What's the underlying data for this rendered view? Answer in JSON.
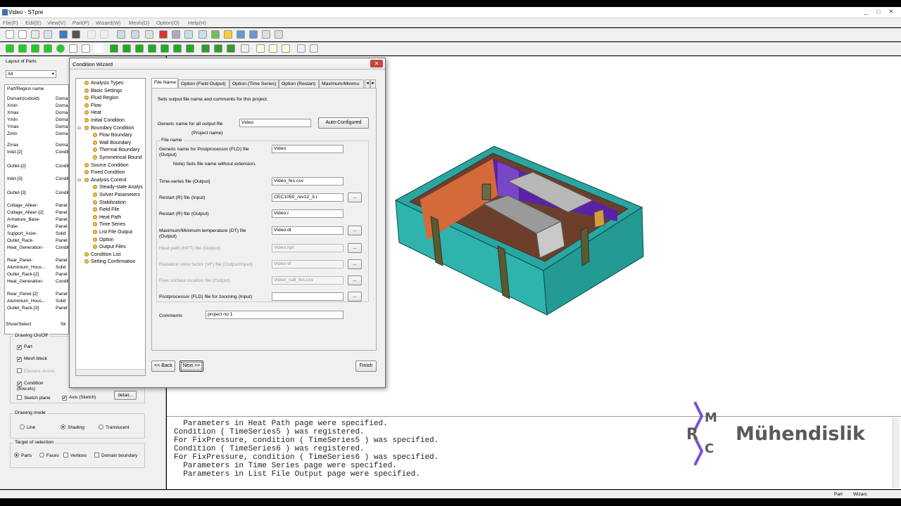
{
  "window": {
    "title": "Video - STpre"
  },
  "menu": [
    "File(F)",
    "Edit(E)",
    "View(V)",
    "Part(P)",
    "Wizard(W)",
    "Mesh(G)",
    "Option(O)",
    "Help(H)"
  ],
  "left_panel": {
    "tab_layout": "Layout of Parts",
    "filter_value": "All",
    "col_part": "Part/Region name",
    "rows": [
      {
        "name": "Domain(cuboid)",
        "type": "Doma"
      },
      {
        "name": "Xmin",
        "type": "Doma"
      },
      {
        "name": "Xmax",
        "type": "Doma"
      },
      {
        "name": "Ymin",
        "type": "Doma"
      },
      {
        "name": "Ymax",
        "type": "Doma"
      },
      {
        "name": "Zmin",
        "type": "Doma"
      },
      {
        "name": "Zmax",
        "type": "Doma"
      },
      {
        "name": "Inlet-[2]",
        "type": "Conditi"
      },
      {
        "name": "Outlet-[2]",
        "type": "Conditi"
      },
      {
        "name": "Inlet-[3]",
        "type": "Conditi"
      },
      {
        "name": "Outlet-[3]",
        "type": "Conditi"
      },
      {
        "name": "Collage_Alleer-",
        "type": "Panel"
      },
      {
        "name": "Collage_Alleer-[2]",
        "type": "Panel"
      },
      {
        "name": "Armature_Base-",
        "type": "Panel"
      },
      {
        "name": "Poile-",
        "type": "Panel"
      },
      {
        "name": "Support_Acier-",
        "type": "Solid"
      },
      {
        "name": "Outlet_Rack-",
        "type": "Panel"
      },
      {
        "name": "Heat_Generation-",
        "type": "Conditi"
      },
      {
        "name": "Rear_Panel-",
        "type": "Panel"
      },
      {
        "name": "Aluminium_Hous...",
        "type": "Solid"
      },
      {
        "name": "Outlet_Rack-[2]",
        "type": "Panel"
      },
      {
        "name": "Heat_Generation-",
        "type": "Conditi"
      },
      {
        "name": "Rear_Panel-[2]",
        "type": "Panel"
      },
      {
        "name": "Aluminium_Hous...",
        "type": "Solid"
      },
      {
        "name": "Outlet_Rack-[3]",
        "type": "Panel"
      }
    ],
    "tab_show": "Show/Select",
    "tab_sketch": "Sk",
    "drawing_onoff": "Drawing On/Off",
    "part": "Part",
    "mesh_block": "Mesh block",
    "element_division": "Element divisio",
    "condition": "Condition (flow,etc)",
    "sketch_plane": "Sketch plane",
    "axis_sketch": "Axis (Sketch)",
    "detail": "detail...",
    "drawing_mode": "Drawing mode",
    "mode_line": "Line",
    "mode_shading": "Shading",
    "mode_translucent": "Translucent",
    "target": "Target of selection",
    "t_parts": "Parts",
    "t_faces": "Faces",
    "t_vertices": "Vertices",
    "t_domain": "Domain boundary"
  },
  "dialog": {
    "title": "Condition Wizard",
    "tree": [
      {
        "label": "Analysis Types",
        "level": 0
      },
      {
        "label": "Basic Settings",
        "level": 0
      },
      {
        "label": "Fluid Region",
        "level": 0
      },
      {
        "label": "Flow",
        "level": 0
      },
      {
        "label": "Heat",
        "level": 0
      },
      {
        "label": "Initial Condition",
        "level": 0
      },
      {
        "label": "Boundary Condition",
        "level": 0
      },
      {
        "label": "Flow Boundary",
        "level": 1
      },
      {
        "label": "Wall Boundary",
        "level": 1
      },
      {
        "label": "Thermal Boundary",
        "level": 1
      },
      {
        "label": "Symmetrical Bound",
        "level": 1
      },
      {
        "label": "Source Condition",
        "level": 0
      },
      {
        "label": "Fixed Condition",
        "level": 0
      },
      {
        "label": "Analysis Control",
        "level": 0
      },
      {
        "label": "Steady-state Analys",
        "level": 1
      },
      {
        "label": "Solver Parameters",
        "level": 1
      },
      {
        "label": "Stabilization",
        "level": 1
      },
      {
        "label": "Field File",
        "level": 1
      },
      {
        "label": "Heat Path",
        "level": 1
      },
      {
        "label": "Time Series",
        "level": 1
      },
      {
        "label": "List File Output",
        "level": 1
      },
      {
        "label": "Option",
        "level": 1
      },
      {
        "label": "Output Files",
        "level": 1
      },
      {
        "label": "Condition List",
        "level": 0
      },
      {
        "label": "Setting Confirmation",
        "level": 0
      }
    ],
    "tabs": [
      "File Name",
      "Option (Field Output)",
      "Option (Time Series)",
      "Option (Restart)",
      "Maximum/Minimu"
    ],
    "description": "Sets output file name and comments for this project.",
    "generic_label": "Generic name for all output file",
    "project_name": "(Project name)",
    "generic_value": "Video",
    "auto_configured": "Auto-Configured",
    "file_name_group": "File name",
    "fields": [
      {
        "label": "Generic name for Postprocessor (FLD) file (Output)",
        "value": "Video",
        "dim": false,
        "browse": false
      },
      {
        "label": "Time-series file (Output)",
        "value": "Video_fes.csv",
        "dim": false,
        "browse": false
      },
      {
        "label": "Restart (R) file (Input)",
        "value": "CEC1050_rev12_3.r",
        "dim": false,
        "browse": true
      },
      {
        "label": "Restart (R) file (Output)",
        "value": "Video.r",
        "dim": false,
        "browse": false
      },
      {
        "label": "Maximum/Minimum temperature (DT) file (Output)",
        "value": "Video.dt",
        "dim": false,
        "browse": true
      },
      {
        "label": "Heat path (HPT) file (Output)",
        "value": "Video.hpt",
        "dim": true,
        "browse": true
      },
      {
        "label": "Radiation view factor (VF) file (Output/Input)",
        "value": "Video.vf",
        "dim": true,
        "browse": true
      },
      {
        "label": "Free surface location file (Output)",
        "value": "Video_sull_fes.csv",
        "dim": true,
        "browse": true
      },
      {
        "label": "Postprocessor (FLD) file for zooming (Input)",
        "value": "",
        "dim": false,
        "browse": true
      }
    ],
    "note": "Note) Sets file name without extension.",
    "comments_label": "Comments",
    "comments_value": "project no 1",
    "back": "<< Back",
    "next": "Next >>",
    "finish": "Finish",
    "browse": "..."
  },
  "console_lines": [
    "  Parameters in Heat Path page were specified.",
    "Condition ( TimeSeries5 ) was registered.",
    "For FixPressure, condition ( TimeSeries5 ) was specified.",
    "Condition ( TimeSeries6 ) was registered.",
    "For FixPressure, condition ( TimeSeries6 ) was specified.",
    "  Parameters in Time Series page were specified.",
    "  Parameters in List File Output page were specified."
  ],
  "status": {
    "part": "Part",
    "wizard": "Wizarc"
  },
  "watermark": {
    "m": "M",
    "r": "R",
    "c": "C",
    "text": "Mühendislik"
  },
  "colors": {
    "teal": "#2aa5a0",
    "purple": "#5a22a8",
    "brick": "#d46a3a",
    "olive": "#5a5a2e",
    "logo_purple": "#7a50d8"
  }
}
